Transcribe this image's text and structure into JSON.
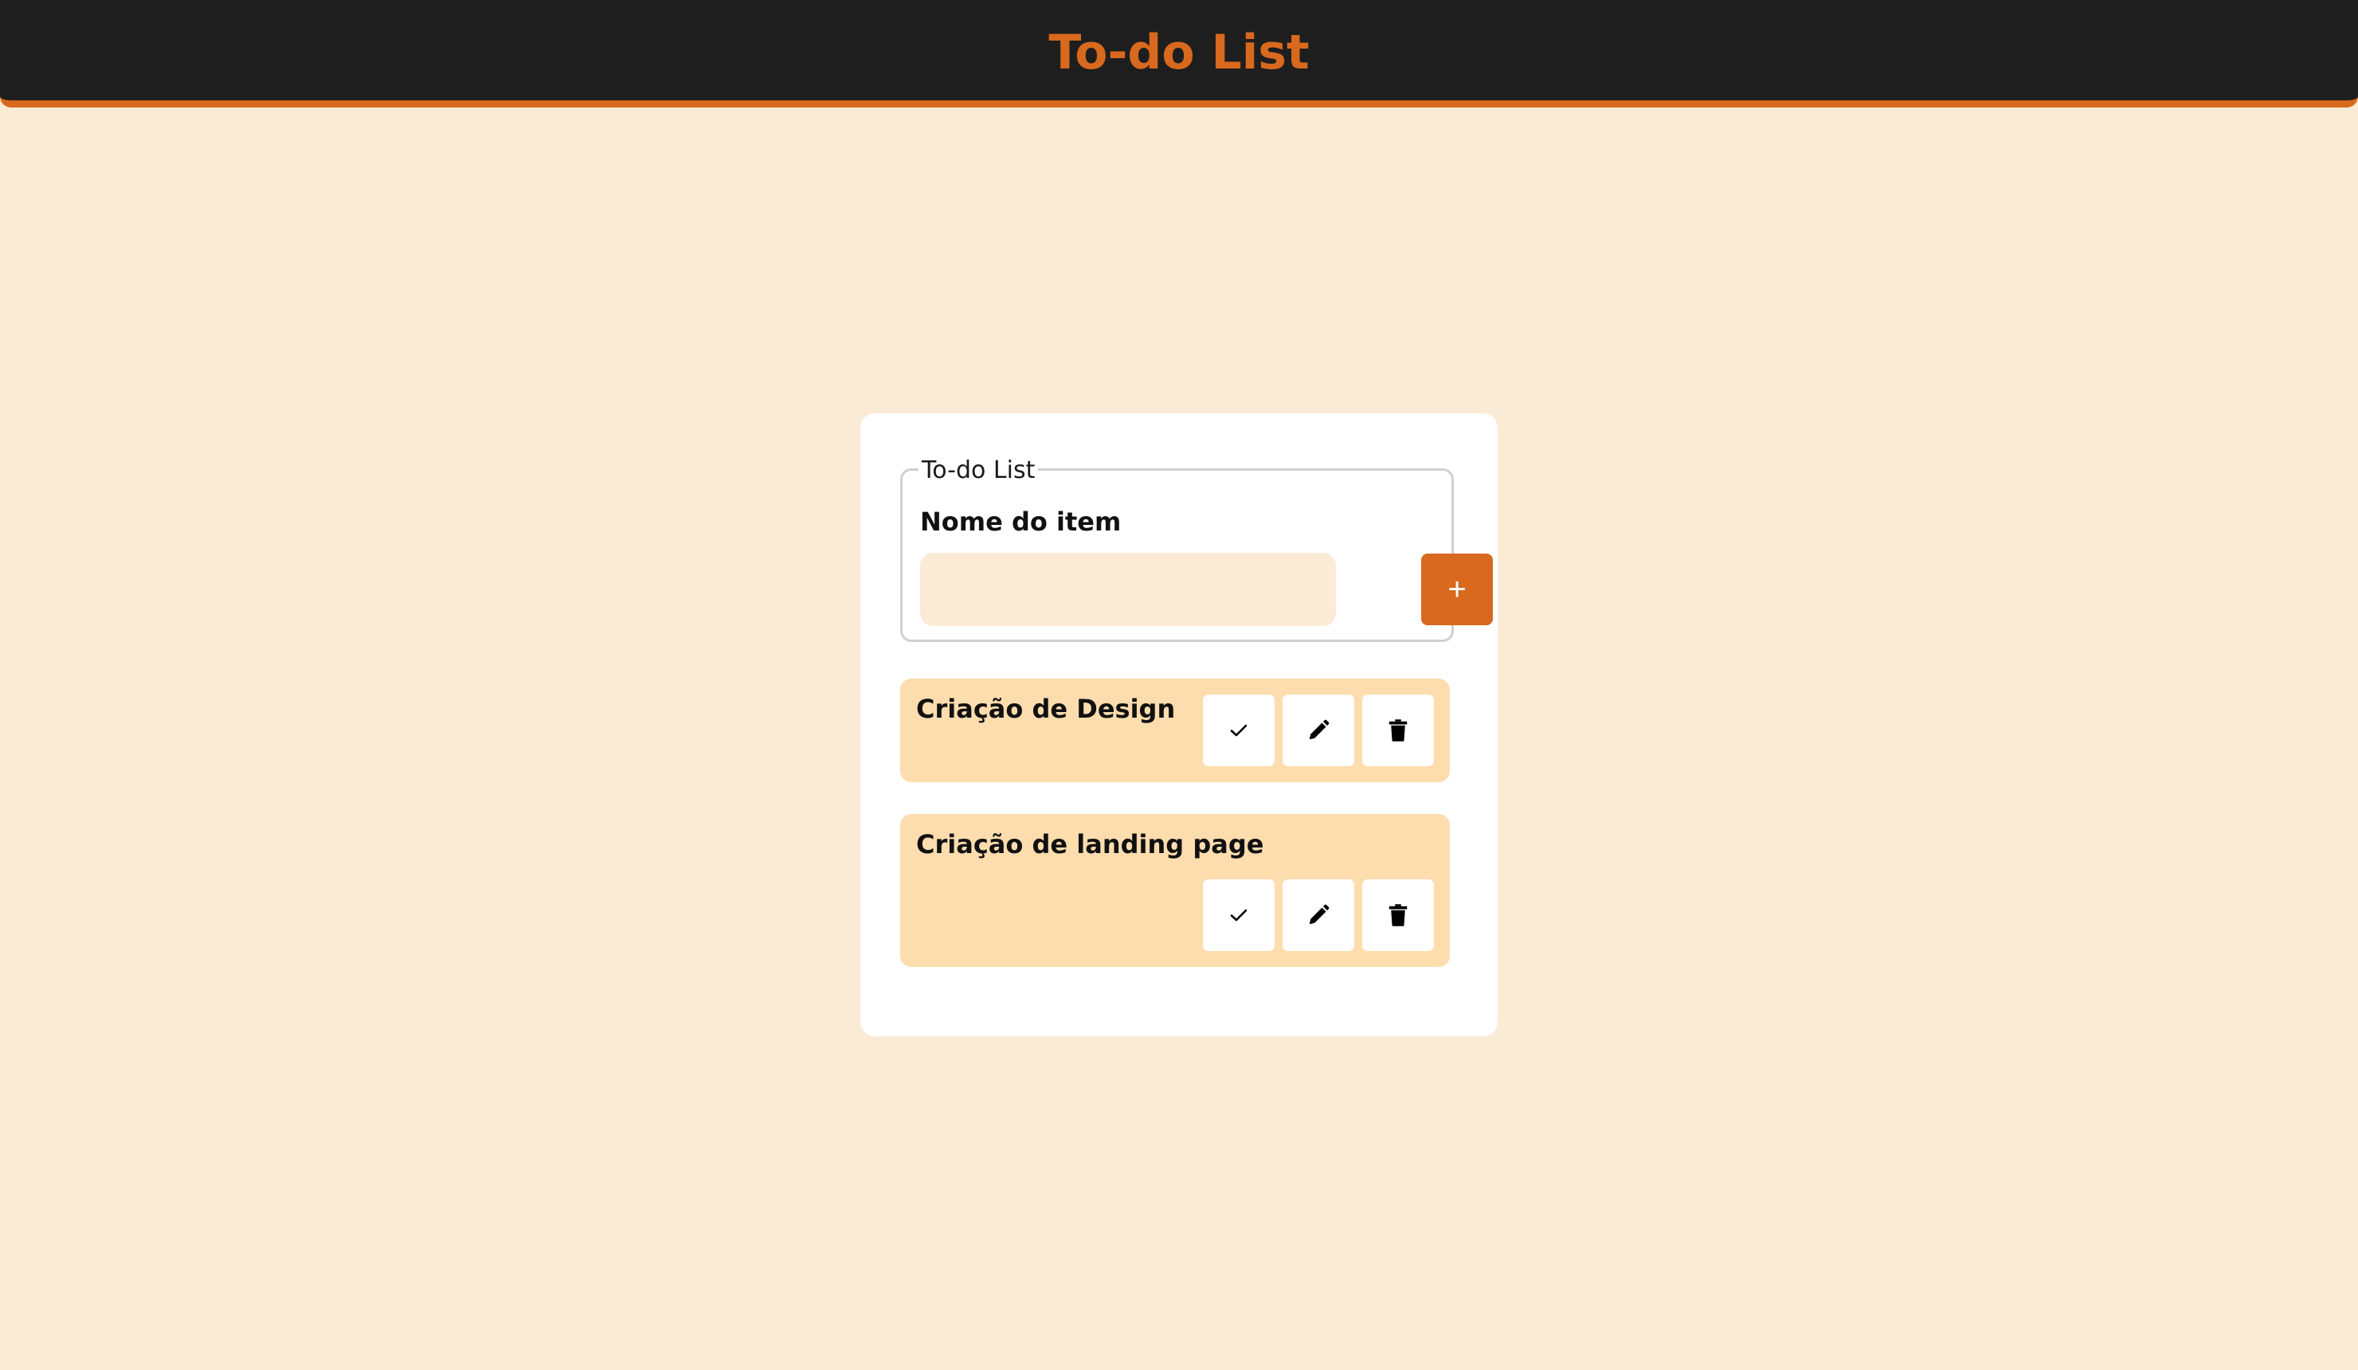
{
  "header": {
    "title": "To-do List"
  },
  "form": {
    "legend": "To-do List",
    "label": "Nome do item",
    "input_value": "",
    "add_button_label": "+"
  },
  "tasks": [
    {
      "title": "Criação de Design",
      "actions": [
        "check-icon",
        "pencil-icon",
        "trash-icon"
      ]
    },
    {
      "title": "Criação de landing page",
      "actions": [
        "check-icon",
        "pencil-icon",
        "trash-icon"
      ]
    }
  ],
  "colors": {
    "background": "#faebd7",
    "header_bg": "#1e1e1e",
    "accent": "#d8691e",
    "task_bg": "#fddcae",
    "input_bg": "#fbebd6",
    "card_bg": "#ffffff"
  }
}
